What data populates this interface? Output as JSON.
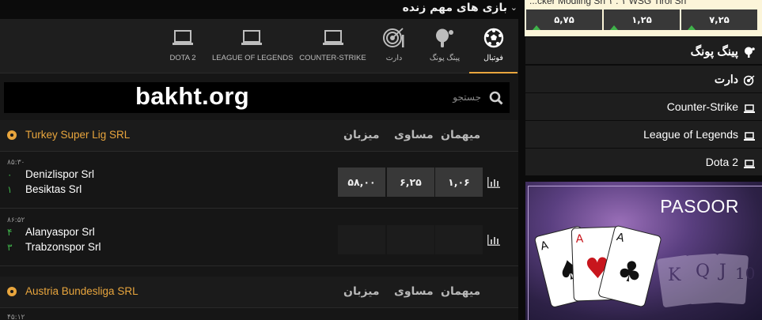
{
  "main": {
    "header_title": "بازی های مهم زنده",
    "tabs": [
      {
        "label": "فوتبال",
        "icon": "soccer-ball-icon",
        "active": true
      },
      {
        "label": "پینگ پونگ",
        "icon": "ping-pong-icon",
        "active": false
      },
      {
        "label": "دارت",
        "icon": "dart-target-icon",
        "active": false
      },
      {
        "label": "COUNTER-STRIKE",
        "icon": "laptop-icon",
        "active": false
      },
      {
        "label": "LEAGUE OF LEGENDS",
        "icon": "laptop-icon",
        "active": false
      },
      {
        "label": "DOTA 2",
        "icon": "laptop-icon",
        "active": false
      }
    ],
    "search": {
      "placeholder": "جستجو",
      "watermark": "bakht.org"
    },
    "column_headers": {
      "home": "میزبان",
      "draw": "مساوی",
      "away": "میهمان"
    },
    "leagues": [
      {
        "name": "Turkey Super Lig SRL",
        "matches": [
          {
            "time": "۸۵:۳۰",
            "team1": "Denizlispor Srl",
            "team2": "Besiktas Srl",
            "score1": "۰",
            "score2": "۱",
            "odds": [
              "۵۸,۰۰",
              "۶,۲۵",
              "۱,۰۶"
            ]
          },
          {
            "time": "۸۶:۵۲",
            "team1": "Alanyaspor Srl",
            "team2": "Trabzonspor Srl",
            "score1": "۴",
            "score2": "۳",
            "odds": [
              "",
              "",
              ""
            ]
          }
        ]
      },
      {
        "name": "Austria Bundesliga SRL",
        "next_time": "۴۵:۱۲"
      }
    ]
  },
  "sidebar": {
    "ticker": {
      "text": "...cker Modling Srl   ۱ : ۱   WSG Tirol Srl",
      "odds": [
        "۵,۷۵",
        "۱,۲۵",
        "۷,۲۵"
      ]
    },
    "items": [
      {
        "label": "پینگ پونگ",
        "icon": "ping-pong-icon",
        "lang": "fa"
      },
      {
        "label": "دارت",
        "icon": "dart-target-icon",
        "lang": "fa"
      },
      {
        "label": "Counter-Strike",
        "icon": "laptop-icon",
        "lang": "en"
      },
      {
        "label": "League of Legends",
        "icon": "laptop-icon",
        "lang": "en"
      },
      {
        "label": "Dota 2",
        "icon": "laptop-icon",
        "lang": "en"
      }
    ],
    "banner": {
      "title": "PASOOR"
    }
  },
  "colors": {
    "accent": "#e8a53d",
    "positive": "#3fb24a",
    "odd_box": "#383838",
    "ticker_bg": "#fcf5d9"
  }
}
